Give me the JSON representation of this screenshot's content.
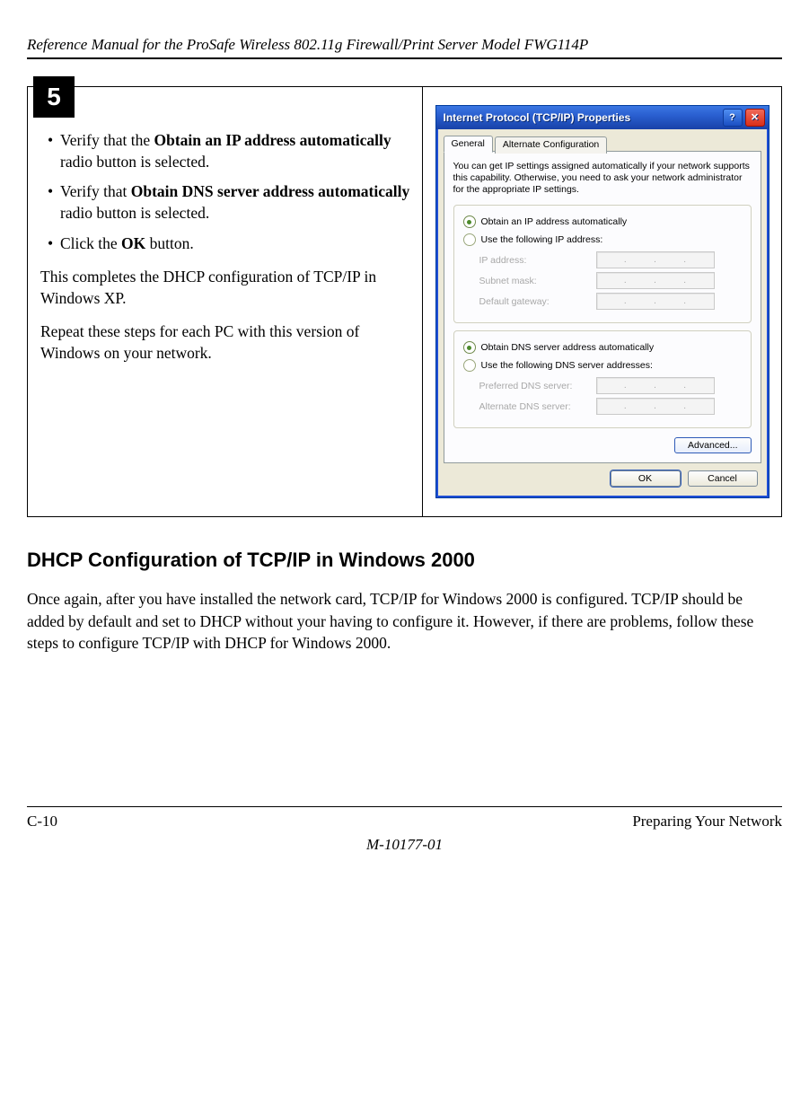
{
  "running_header": "Reference Manual for the ProSafe Wireless 802.11g  Firewall/Print Server Model FWG114P",
  "step_number": "5",
  "bullets": [
    {
      "pre": "Verify that the ",
      "bold": "Obtain an IP address automatically",
      "post": " radio button is selected."
    },
    {
      "pre": "Verify that ",
      "bold": "Obtain DNS server address automatically",
      "post": " radio button is selected."
    },
    {
      "pre": "Click the ",
      "bold": "OK",
      "post": " button."
    }
  ],
  "left_para1": "This completes the DHCP configuration of TCP/IP in Windows XP.",
  "left_para2": "Repeat these steps for each PC with this version of Windows on your network.",
  "dialog": {
    "title": "Internet Protocol (TCP/IP) Properties",
    "help_glyph": "?",
    "close_glyph": "✕",
    "tab_general": "General",
    "tab_alt": "Alternate Configuration",
    "help_text": "You can get IP settings assigned automatically if your network supports this capability. Otherwise, you need to ask your network administrator for the appropriate IP settings.",
    "radio_ip_auto": "Obtain an IP address automatically",
    "radio_ip_manual": "Use the following IP address:",
    "lbl_ip": "IP address:",
    "lbl_subnet": "Subnet mask:",
    "lbl_gateway": "Default gateway:",
    "radio_dns_auto": "Obtain DNS server address automatically",
    "radio_dns_manual": "Use the following DNS server addresses:",
    "lbl_pref_dns": "Preferred DNS server:",
    "lbl_alt_dns": "Alternate DNS server:",
    "btn_advanced": "Advanced...",
    "btn_ok": "OK",
    "btn_cancel": "Cancel",
    "ip_dot": "."
  },
  "section_heading": "DHCP Configuration of TCP/IP in Windows 2000",
  "section_body": "Once again, after you have installed the network card, TCP/IP for Windows 2000 is configured. TCP/IP should be added by default and set to DHCP without your having to configure it. However, if there are problems, follow these steps to configure TCP/IP with DHCP for Windows 2000.",
  "footer_left": "C-10",
  "footer_right": "Preparing Your Network",
  "doc_id": "M-10177-01"
}
